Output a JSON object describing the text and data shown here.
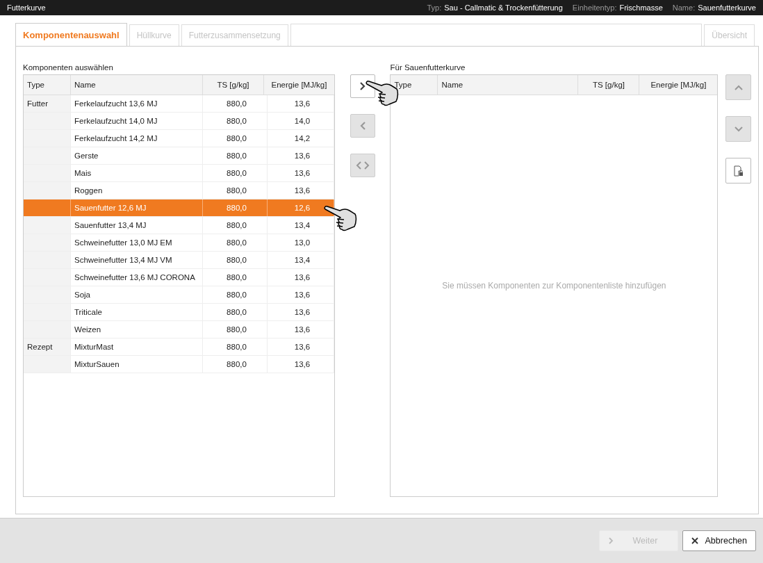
{
  "window": {
    "title": "Futterkurve"
  },
  "header_info": [
    {
      "label": "Typ:",
      "value": "Sau - Callmatic & Trockenfütterung"
    },
    {
      "label": "Einheitentyp:",
      "value": "Frischmasse"
    },
    {
      "label": "Name:",
      "value": "Sauenfutterkurve"
    }
  ],
  "tabs": [
    {
      "label": "Komponentenauswahl",
      "selected": true,
      "disabled": false
    },
    {
      "label": "Hüllkurve",
      "selected": false,
      "disabled": true
    },
    {
      "label": "Futterzusammensetzung",
      "selected": false,
      "disabled": true
    }
  ],
  "overview_tab": {
    "label": "Übersicht",
    "disabled": true
  },
  "left_table": {
    "title": "Komponenten auswählen",
    "columns": [
      "Type",
      "Name",
      "TS [g/kg]",
      "Energie [MJ/kg]"
    ],
    "rows": [
      {
        "type": "Futter",
        "name": "Ferkelaufzucht 13,6 MJ",
        "ts": "880,0",
        "energie": "13,6",
        "selected": false
      },
      {
        "type": "",
        "name": "Ferkelaufzucht 14,0 MJ",
        "ts": "880,0",
        "energie": "14,0",
        "selected": false
      },
      {
        "type": "",
        "name": "Ferkelaufzucht 14,2 MJ",
        "ts": "880,0",
        "energie": "14,2",
        "selected": false
      },
      {
        "type": "",
        "name": "Gerste",
        "ts": "880,0",
        "energie": "13,6",
        "selected": false
      },
      {
        "type": "",
        "name": "Mais",
        "ts": "880,0",
        "energie": "13,6",
        "selected": false
      },
      {
        "type": "",
        "name": "Roggen",
        "ts": "880,0",
        "energie": "13,6",
        "selected": false
      },
      {
        "type": "",
        "name": "Sauenfutter 12,6 MJ",
        "ts": "880,0",
        "energie": "12,6",
        "selected": true
      },
      {
        "type": "",
        "name": "Sauenfutter 13,4 MJ",
        "ts": "880,0",
        "energie": "13,4",
        "selected": false
      },
      {
        "type": "",
        "name": "Schweinefutter 13,0 MJ EM",
        "ts": "880,0",
        "energie": "13,0",
        "selected": false
      },
      {
        "type": "",
        "name": "Schweinefutter 13,4 MJ VM",
        "ts": "880,0",
        "energie": "13,4",
        "selected": false
      },
      {
        "type": "",
        "name": "Schweinefutter 13,6 MJ CORONA",
        "ts": "880,0",
        "energie": "13,6",
        "selected": false
      },
      {
        "type": "",
        "name": "Soja",
        "ts": "880,0",
        "energie": "13,6",
        "selected": false
      },
      {
        "type": "",
        "name": "Triticale",
        "ts": "880,0",
        "energie": "13,6",
        "selected": false
      },
      {
        "type": "",
        "name": "Weizen",
        "ts": "880,0",
        "energie": "13,6",
        "selected": false
      },
      {
        "type": "Rezept",
        "name": "MixturMast",
        "ts": "880,0",
        "energie": "13,6",
        "selected": false
      },
      {
        "type": "",
        "name": "MixturSauen",
        "ts": "880,0",
        "energie": "13,6",
        "selected": false
      }
    ]
  },
  "transfer_buttons": [
    {
      "kind": "add",
      "disabled": false
    },
    {
      "kind": "remove",
      "disabled": true
    },
    {
      "kind": "swap",
      "disabled": true
    }
  ],
  "right_table": {
    "title": "Für Sauenfutterkurve",
    "columns": [
      "Type",
      "Name",
      "TS [g/kg]",
      "Energie [MJ/kg]"
    ],
    "empty_message": "Sie müssen Komponenten zur Komponentenliste hinzufügen"
  },
  "order_buttons": [
    {
      "kind": "up",
      "disabled": true
    },
    {
      "kind": "down",
      "disabled": true
    },
    {
      "kind": "lock",
      "disabled": false
    }
  ],
  "footer": {
    "buttons": [
      {
        "kind": "next",
        "label": "Weiter",
        "disabled": true
      },
      {
        "kind": "cancel",
        "label": "Abbrechen",
        "disabled": false
      }
    ]
  }
}
